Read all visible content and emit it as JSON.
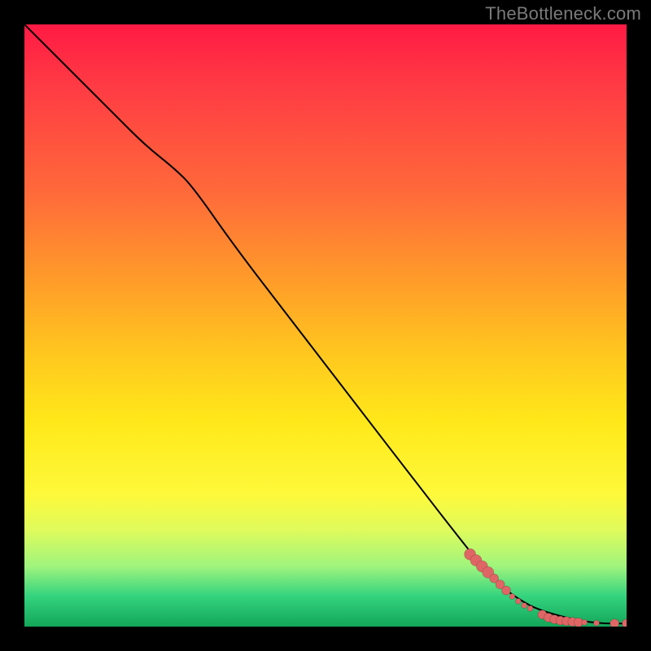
{
  "watermark": "TheBottleneck.com",
  "chart_data": {
    "type": "line",
    "title": "",
    "xlabel": "",
    "ylabel": "",
    "xlim": [
      0,
      100
    ],
    "ylim": [
      0,
      100
    ],
    "grid": false,
    "legend": false,
    "background_gradient": {
      "direction": "vertical",
      "stops": [
        {
          "pos": 0.0,
          "color": "#ff1a44"
        },
        {
          "pos": 0.1,
          "color": "#ff3a44"
        },
        {
          "pos": 0.28,
          "color": "#ff6a3a"
        },
        {
          "pos": 0.42,
          "color": "#ff9a2a"
        },
        {
          "pos": 0.55,
          "color": "#ffc81e"
        },
        {
          "pos": 0.66,
          "color": "#ffe81a"
        },
        {
          "pos": 0.78,
          "color": "#fef93a"
        },
        {
          "pos": 0.84,
          "color": "#dffb5c"
        },
        {
          "pos": 0.9,
          "color": "#9ff47d"
        },
        {
          "pos": 0.95,
          "color": "#33d37e"
        },
        {
          "pos": 1.0,
          "color": "#13a65a"
        }
      ]
    },
    "series": [
      {
        "name": "bottleneck-curve",
        "x": [
          0,
          5,
          10,
          15,
          20,
          25,
          28,
          35,
          45,
          55,
          65,
          72,
          76,
          80,
          83,
          85,
          88,
          92,
          96,
          100
        ],
        "y": [
          100,
          95,
          90,
          85,
          80,
          76,
          73,
          63,
          50,
          37,
          24,
          15,
          10,
          6,
          4,
          3,
          2,
          1,
          0.5,
          0.5
        ]
      }
    ],
    "markers": {
      "name": "highlighted-range",
      "color": "#e06666",
      "points": [
        {
          "x": 74,
          "y": 12,
          "size": "lg"
        },
        {
          "x": 75,
          "y": 11,
          "size": "lg"
        },
        {
          "x": 76,
          "y": 10,
          "size": "lg"
        },
        {
          "x": 77,
          "y": 9,
          "size": "lg"
        },
        {
          "x": 78,
          "y": 8,
          "size": "md"
        },
        {
          "x": 79,
          "y": 7,
          "size": "md"
        },
        {
          "x": 80,
          "y": 6,
          "size": "md"
        },
        {
          "x": 81,
          "y": 5,
          "size": "sm"
        },
        {
          "x": 82,
          "y": 4.2,
          "size": "sm"
        },
        {
          "x": 83,
          "y": 3.5,
          "size": "sm"
        },
        {
          "x": 84,
          "y": 3.0,
          "size": "sm"
        },
        {
          "x": 86,
          "y": 2.0,
          "size": "md"
        },
        {
          "x": 87,
          "y": 1.5,
          "size": "md"
        },
        {
          "x": 88,
          "y": 1.2,
          "size": "md"
        },
        {
          "x": 89,
          "y": 1.0,
          "size": "md"
        },
        {
          "x": 90,
          "y": 0.9,
          "size": "md"
        },
        {
          "x": 91,
          "y": 0.8,
          "size": "md"
        },
        {
          "x": 92,
          "y": 0.7,
          "size": "md"
        },
        {
          "x": 93,
          "y": 0.7,
          "size": "sm"
        },
        {
          "x": 95,
          "y": 0.6,
          "size": "sm"
        },
        {
          "x": 98,
          "y": 0.5,
          "size": "md"
        },
        {
          "x": 100,
          "y": 0.5,
          "size": "md"
        }
      ]
    }
  }
}
